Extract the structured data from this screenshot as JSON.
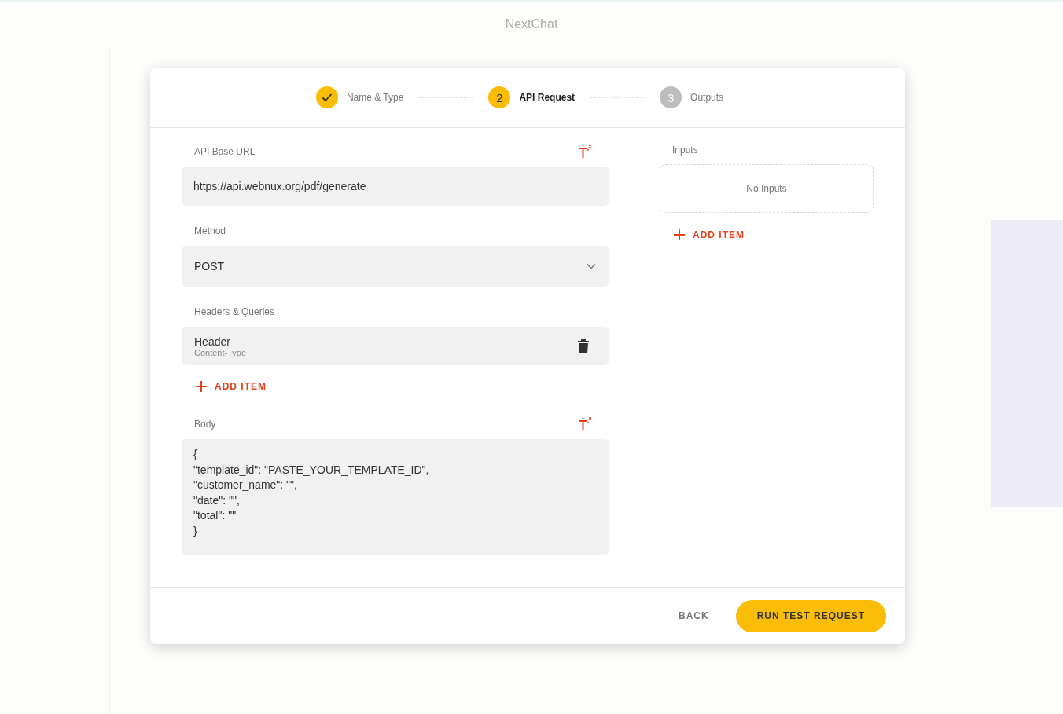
{
  "app_bar": {
    "title": "NextChat"
  },
  "stepper": [
    {
      "label": "Name & Type",
      "completed": true,
      "selected": false
    },
    {
      "label": "API Request",
      "number": "2",
      "completed": false,
      "selected": true
    },
    {
      "label": "Outputs",
      "number": "3",
      "completed": false,
      "selected": false
    }
  ],
  "fields": [
    {
      "kind": "text",
      "label": "API Base URL",
      "value": "https://api.webnux.org/pdf/generate",
      "magic": true
    },
    {
      "kind": "select",
      "label": "Method",
      "value": "POST"
    },
    {
      "kind": "list",
      "label": "Headers & Queries",
      "items": [
        {
          "title": "Header",
          "subtitle": "Content-Type"
        }
      ],
      "add_label": "ADD ITEM"
    },
    {
      "kind": "code",
      "label": "Body",
      "magic": true,
      "lines": [
        "{",
        "\"template_id\": \"PASTE_YOUR_TEMPLATE_ID\",",
        "\"customer_name\": \"\",",
        "\"date\": \"\",",
        "\"total\": \"\"",
        "}"
      ]
    }
  ],
  "inputs": {
    "label": "Inputs",
    "empty_text": "No Inputs",
    "add_label": "ADD ITEM"
  },
  "footer": {
    "back": "BACK",
    "primary": "RUN TEST REQUEST"
  }
}
